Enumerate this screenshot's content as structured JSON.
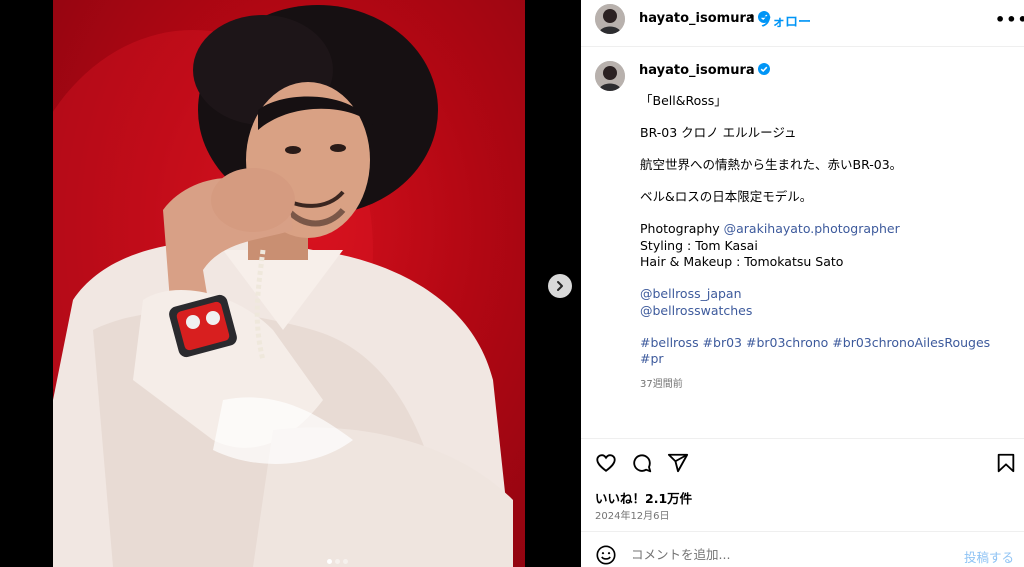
{
  "post": {
    "username": "hayato_isomura",
    "follow_label": "フォロー",
    "header_separator": "•",
    "caption_separator": ".",
    "caption": {
      "line1": "「Bell&Ross」",
      "line2": "BR-03 クロノ エルルージュ",
      "line3": "航空世界への情熱から生まれた、赤いBR-03。",
      "line4": "ベル&ロスの日本限定モデル。",
      "photo_prefix": "Photography ",
      "photo_handle": "@arakihayato.photographer",
      "styling": "Styling : Tom Kasai",
      "hair": "Hair & Makeup : Tomokatsu Sato",
      "tag1": "@bellross_japan",
      "tag2": "@bellrosswatches",
      "hashtags": "#bellross #br03 #br03chrono #br03chronoAilesRouges",
      "hashtags2": "#pr"
    },
    "time_ago": "37週間前",
    "likes": "いいね！2.1万件",
    "date": "2024年12月6日",
    "comment_placeholder": "コメントを追加...",
    "post_label": "投稿する",
    "carousel": {
      "count": 3,
      "active": 1
    }
  },
  "colors": {
    "accent": "#0095f6",
    "link": "#3d5a9c",
    "muted": "#737373",
    "photo_bg": "#c20a16"
  },
  "icons": [
    "verified-icon",
    "more-icon",
    "heart-icon",
    "comment-icon",
    "share-icon",
    "bookmark-icon",
    "emoji-icon",
    "next-icon"
  ]
}
